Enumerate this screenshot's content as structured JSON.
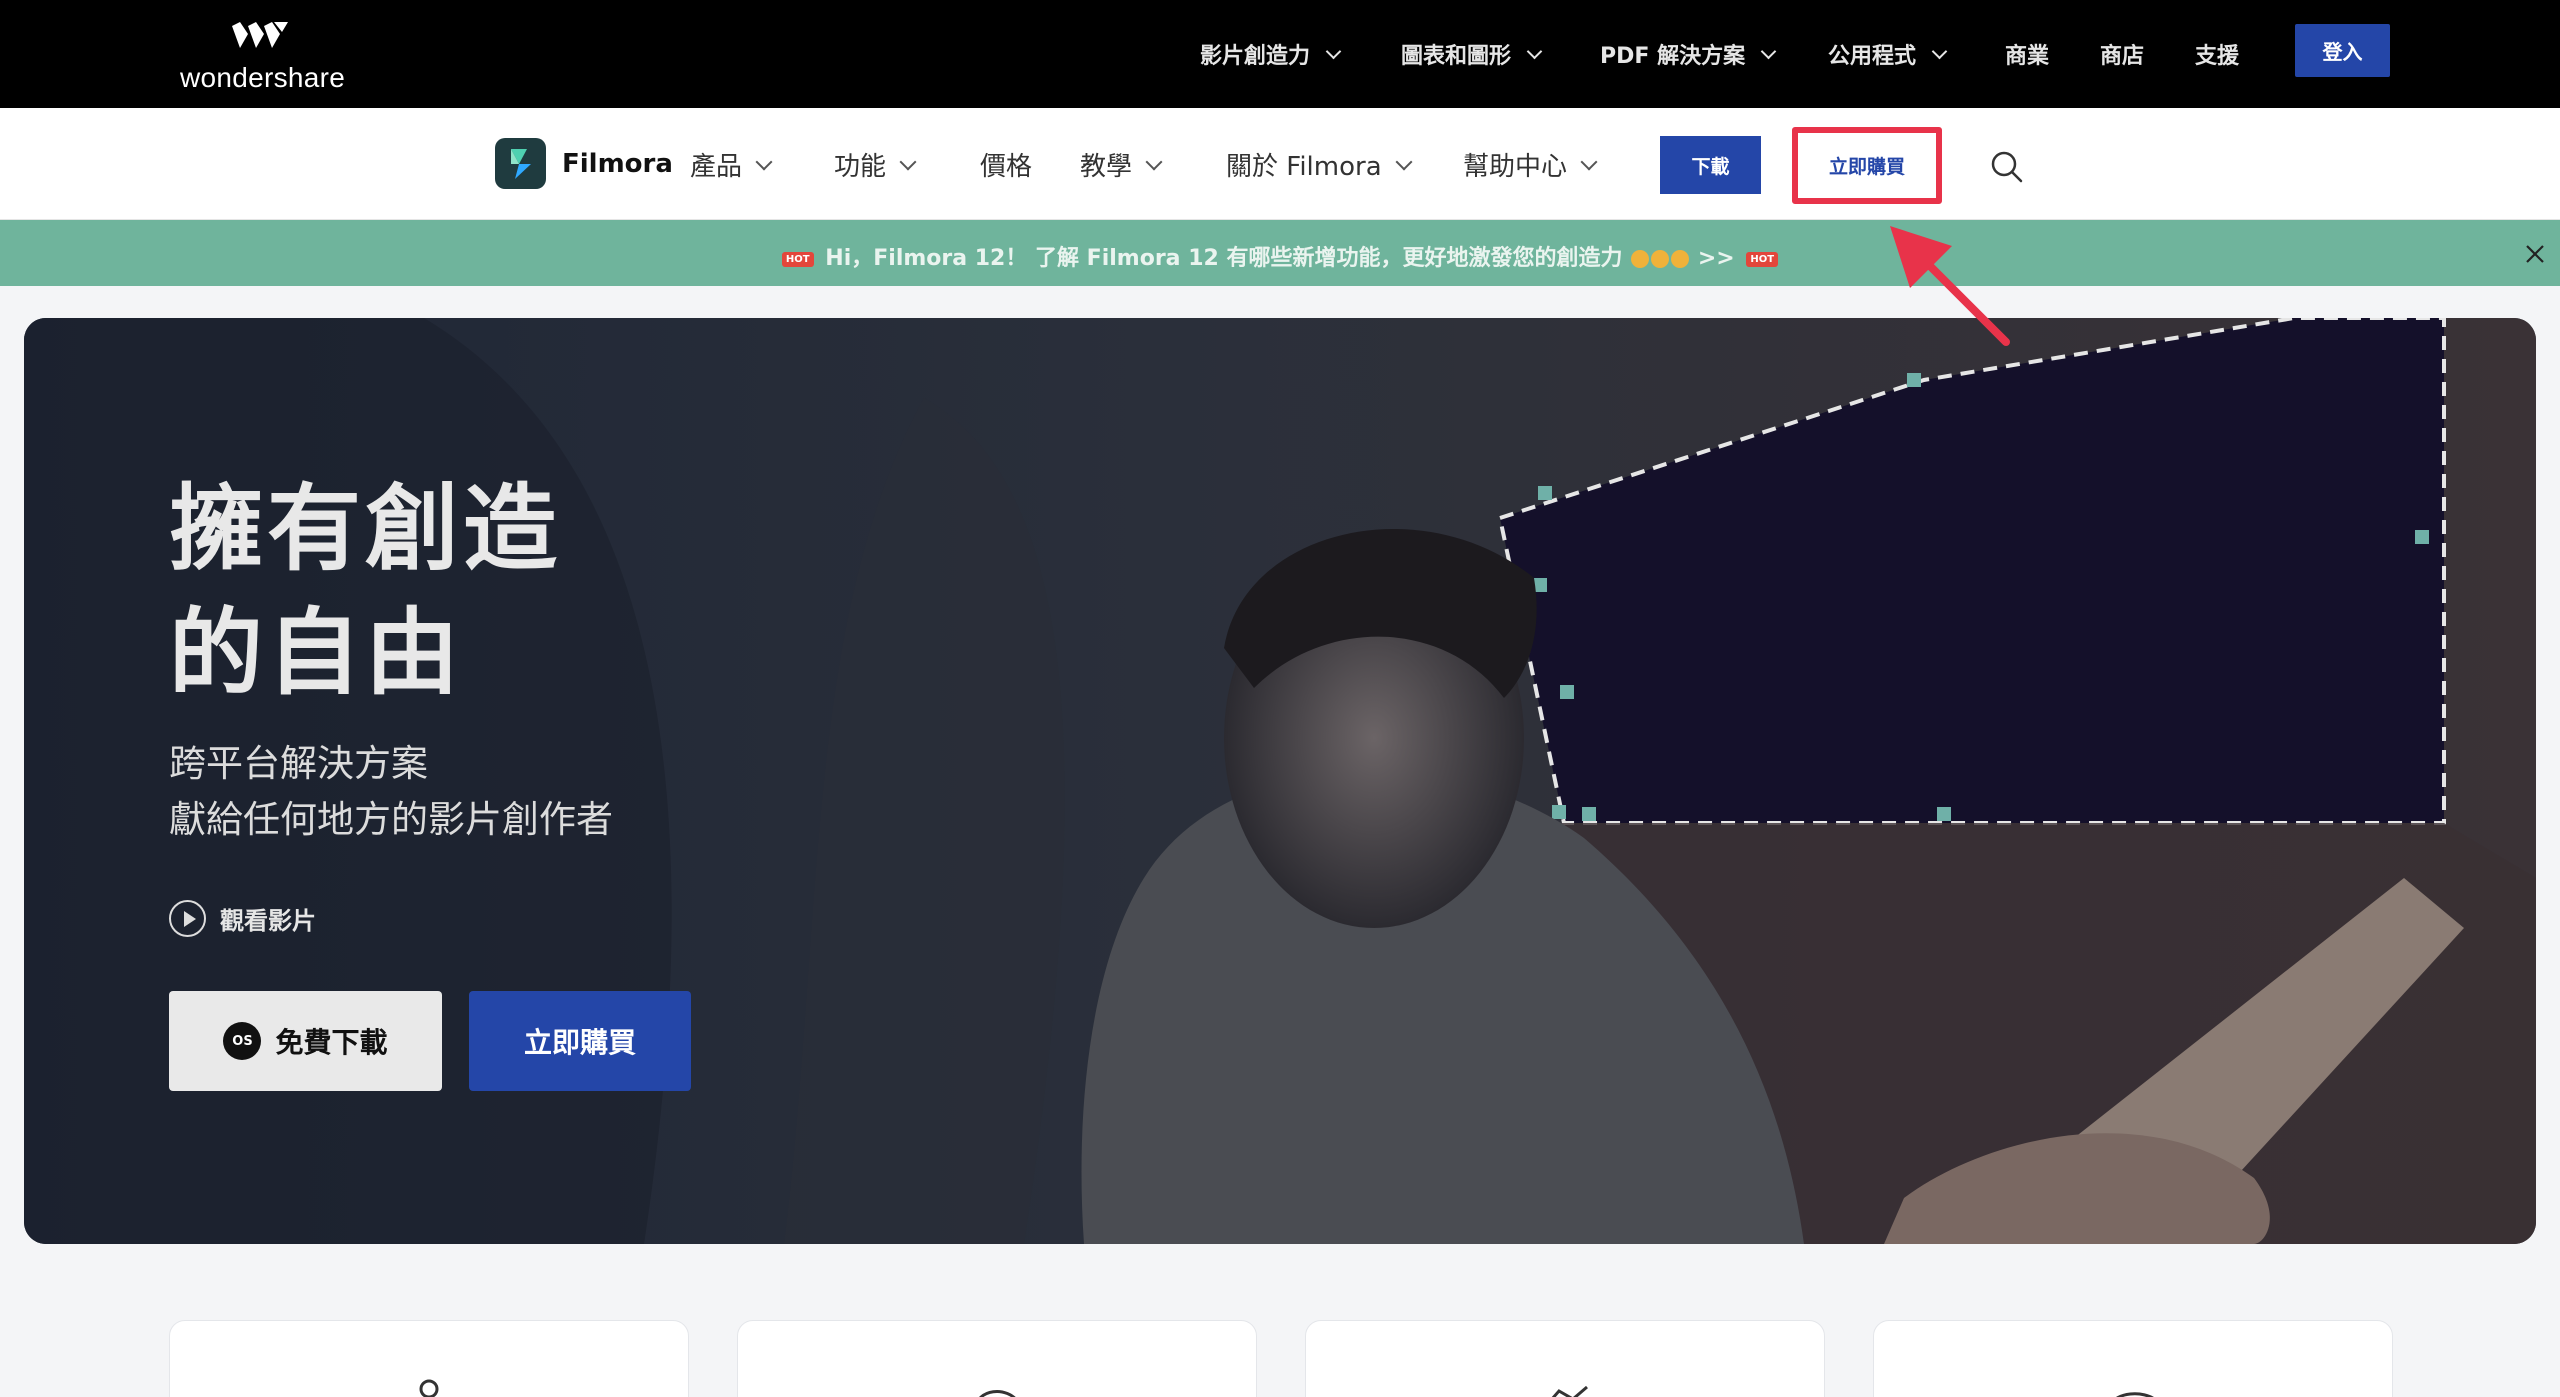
{
  "brand": {
    "name": "wondershare"
  },
  "topnav": {
    "items": [
      {
        "label": "影片創造力",
        "dropdown": true
      },
      {
        "label": "圖表和圖形",
        "dropdown": true
      },
      {
        "label": "PDF 解決方案",
        "dropdown": true
      },
      {
        "label": "公用程式",
        "dropdown": true
      },
      {
        "label": "商業",
        "dropdown": false
      },
      {
        "label": "商店",
        "dropdown": false
      },
      {
        "label": "支援",
        "dropdown": false
      }
    ],
    "login_label": "登入"
  },
  "subnav": {
    "product_name": "Filmora",
    "items": [
      {
        "label": "產品",
        "dropdown": true
      },
      {
        "label": "功能",
        "dropdown": true
      },
      {
        "label": "價格",
        "dropdown": false
      },
      {
        "label": "教學",
        "dropdown": true
      },
      {
        "label": "關於 Filmora",
        "dropdown": true
      },
      {
        "label": "幫助中心",
        "dropdown": true
      }
    ],
    "download_label": "下載",
    "buy_label": "立即購買"
  },
  "announcement": {
    "hot": "HOT",
    "text": "Hi，Filmora 12！ 了解 Filmora 12 有哪些新增功能，更好地激發您的創造力",
    "suffix": ">>"
  },
  "hero": {
    "title_line1": "擁有創造",
    "title_line2": "的自由",
    "sub_line1": "跨平台解決方案",
    "sub_line2": "獻給任何地方的影片創作者",
    "watch_label": "觀看影片",
    "free_download_label": "免費下載",
    "os_badge": "OS",
    "buy_label": "立即購買"
  },
  "colors": {
    "accent": "#2446a8",
    "highlight": "#e8334a",
    "banner": "#6fb49c"
  }
}
